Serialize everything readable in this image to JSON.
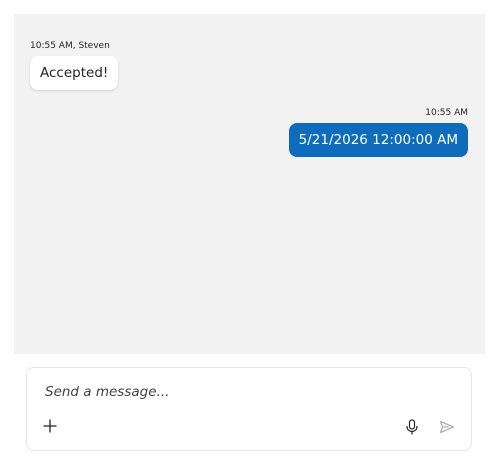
{
  "messages": [
    {
      "meta": "10:55 AM, Steven",
      "text": "Accepted!",
      "direction": "received"
    },
    {
      "meta": "10:55 AM",
      "text": "5/21/2026 12:00:00 AM",
      "direction": "sent"
    }
  ],
  "composer": {
    "placeholder": "Send a message...",
    "add_icon": "plus-icon",
    "mic_icon": "microphone-icon",
    "send_icon": "send-icon"
  },
  "colors": {
    "sent_bubble": "#0f6cbd",
    "messages_background": "#f2f2f2",
    "send_disabled": "#b0b0b0"
  }
}
